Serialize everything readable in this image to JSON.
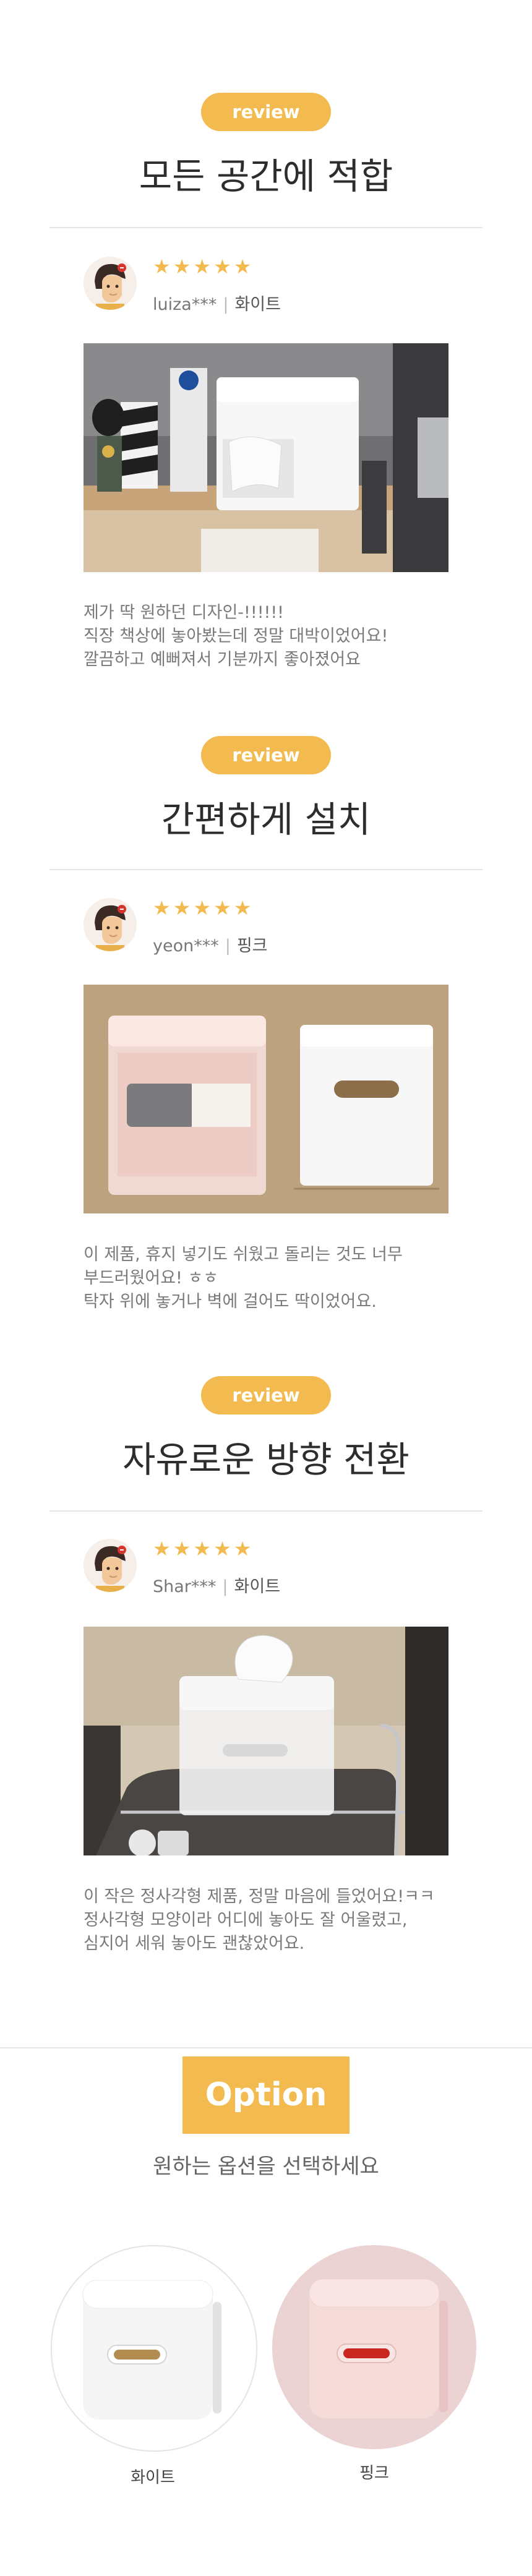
{
  "colors": {
    "accent": "#f3bb4f",
    "pink": "#e8c8c8"
  },
  "reviews": [
    {
      "badge": "review",
      "heading": "모든 공간에 적합",
      "stars": "★★★★★",
      "user": "luiza***",
      "option": "화이트",
      "text": "제가 딱 원하던 디자인-!!!!!!\n직장 책상에 놓아봤는데 정말 대박이었어요!\n깔끔하고 예뻐져서 기분까지 좋아졌어요"
    },
    {
      "badge": "review",
      "heading": "간편하게 설치",
      "stars": "★★★★★",
      "user": "yeon***",
      "option": "핑크",
      "text": "이 제품, 휴지 넣기도 쉬웠고 돌리는 것도 너무\n부드러웠어요!  ㅎㅎ\n탁자 위에 놓거나 벽에 걸어도 딱이었어요."
    },
    {
      "badge": "review",
      "heading": "자유로운 방향 전환",
      "stars": "★★★★★",
      "user": "Shar***",
      "option": "화이트",
      "text": "이 작은 정사각형 제품, 정말 마음에 들었어요!ㅋㅋ\n정사각형 모양이라 어디에 놓아도 잘 어울렸고,\n심지어 세워 놓아도 괜찮았어요."
    }
  ],
  "option": {
    "title": "Option",
    "subtitle": "원하는 옵션을 선택하세요",
    "choices": [
      {
        "label": "화이트"
      },
      {
        "label": "핑크"
      }
    ]
  }
}
